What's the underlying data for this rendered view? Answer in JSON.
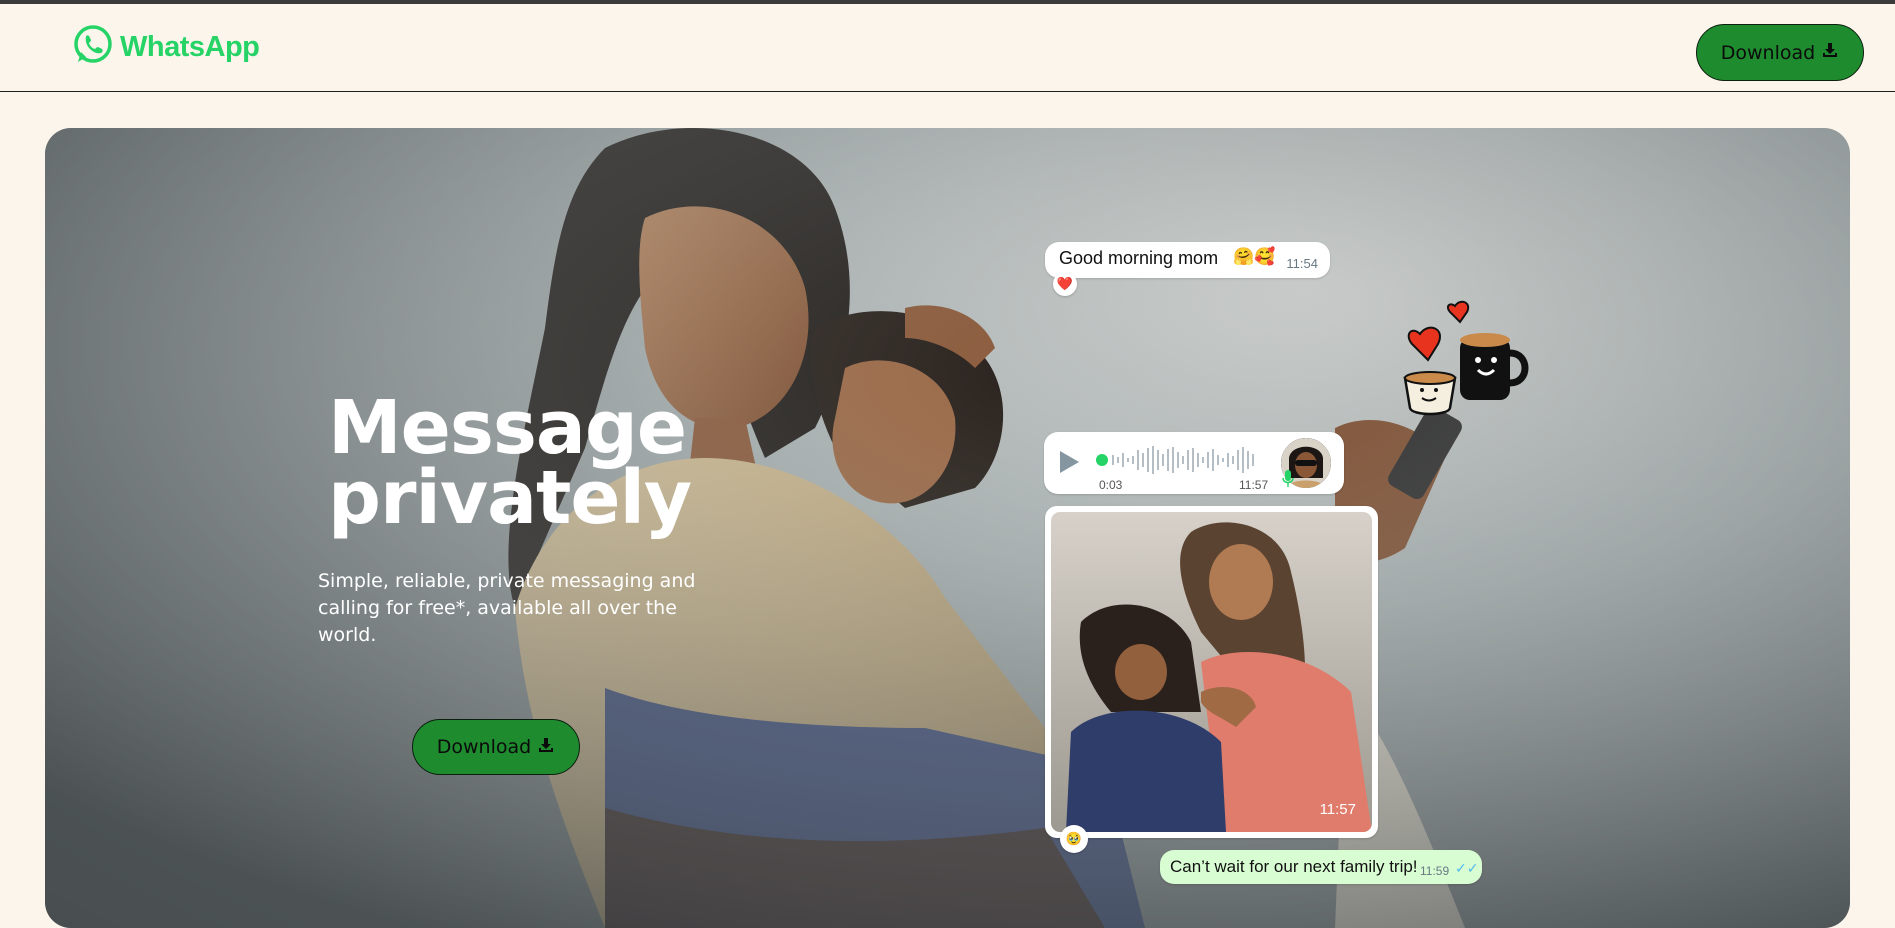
{
  "header": {
    "brand": "WhatsApp",
    "download_label": "Download"
  },
  "hero": {
    "title_line1": "Message",
    "title_line2": "privately",
    "subtitle": "Simple, reliable, private messaging and calling for free*, available all over the world.",
    "download_label": "Download"
  },
  "chat": {
    "morning": {
      "text": "Good morning mom",
      "emojis": "🤗🥰",
      "time": "11:54",
      "reaction": "❤️"
    },
    "voice": {
      "duration": "0:03",
      "time": "11:57"
    },
    "photo": {
      "time": "11:57",
      "reaction": "🥹"
    },
    "trip": {
      "text": "Can’t wait for our next family trip!",
      "time": "11:59",
      "ticks": "✓✓"
    }
  },
  "icons": {
    "logo": "whatsapp-logo-icon",
    "download": "download-icon",
    "play": "play-icon",
    "mic": "mic-icon"
  },
  "colors": {
    "brand_green": "#25d366",
    "button_green": "#1e8c2e",
    "page_bg": "#fcf5eb",
    "outgoing_bubble": "#d9fdd3",
    "read_ticks": "#53bdeb"
  }
}
